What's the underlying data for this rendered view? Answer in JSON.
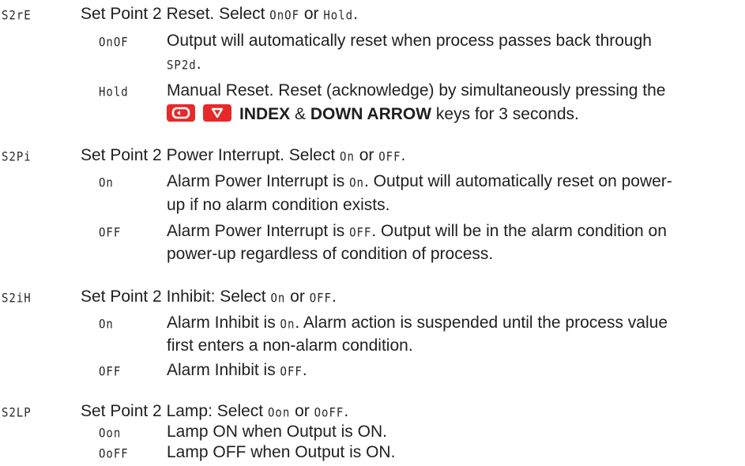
{
  "sections": [
    {
      "code": "S2rE",
      "title_pre": "Set Point 2 Reset. Select ",
      "title_opt1": "OnOF",
      "title_mid": " or ",
      "title_opt2": "Hold",
      "title_post": ".",
      "options": [
        {
          "code": "OnOF",
          "line1": "Output will automatically reset when process passes back through",
          "line2_code": "SP2d",
          "line2_post": "."
        },
        {
          "code": "Hold",
          "line1": "Manual Reset. Reset (acknowledge) by simultaneously pressing the",
          "line2_b1": "INDEX",
          "line2_amp": " & ",
          "line2_b2": "DOWN ARROW",
          "line2_post": " keys for 3 seconds."
        }
      ]
    },
    {
      "code": "S2Pi",
      "title_pre": "Set Point 2 Power Interrupt. Select ",
      "title_opt1": "On",
      "title_mid": " or ",
      "title_opt2": "OFF",
      "title_post": ".",
      "options": [
        {
          "code": "On",
          "line1_pre": "Alarm Power Interrupt is ",
          "line1_code": "On",
          "line1_post": ". Output will automatically reset on power-",
          "line2": "up if no alarm condition exists."
        },
        {
          "code": "OFF",
          "line1_pre": "Alarm Power Interrupt is ",
          "line1_code": "OFF",
          "line1_post": ". Output will be in the alarm condition on",
          "line2": "power-up regardless of condition of process."
        }
      ]
    },
    {
      "code": "S2iH",
      "title_pre": "Set Point 2 Inhibit: Select ",
      "title_opt1": "On",
      "title_mid": " or ",
      "title_opt2": "OFF",
      "title_post": ".",
      "options": [
        {
          "code": "On",
          "line1_pre": "Alarm Inhibit is ",
          "line1_code": "On",
          "line1_post": ". Alarm action is suspended until the process value",
          "line2": "first enters a non-alarm condition."
        },
        {
          "code": "OFF",
          "line1_pre": "Alarm Inhibit is ",
          "line1_code": "OFF",
          "line1_post": "."
        }
      ]
    },
    {
      "code": "S2LP",
      "title_pre": "Set Point 2 Lamp: Select ",
      "title_opt1": "Oon",
      "title_mid": " or ",
      "title_opt2": "OoFF",
      "title_post": ".",
      "options": [
        {
          "code": "Oon",
          "line1": "Lamp ON when Output is ON."
        },
        {
          "code": "OoFF",
          "line1": "Lamp OFF when Output is ON."
        }
      ]
    }
  ],
  "colors": {
    "key_red": "#e62a2a",
    "text": "#1f1f1f"
  },
  "icons": [
    "index-key-icon",
    "down-arrow-key-icon"
  ]
}
